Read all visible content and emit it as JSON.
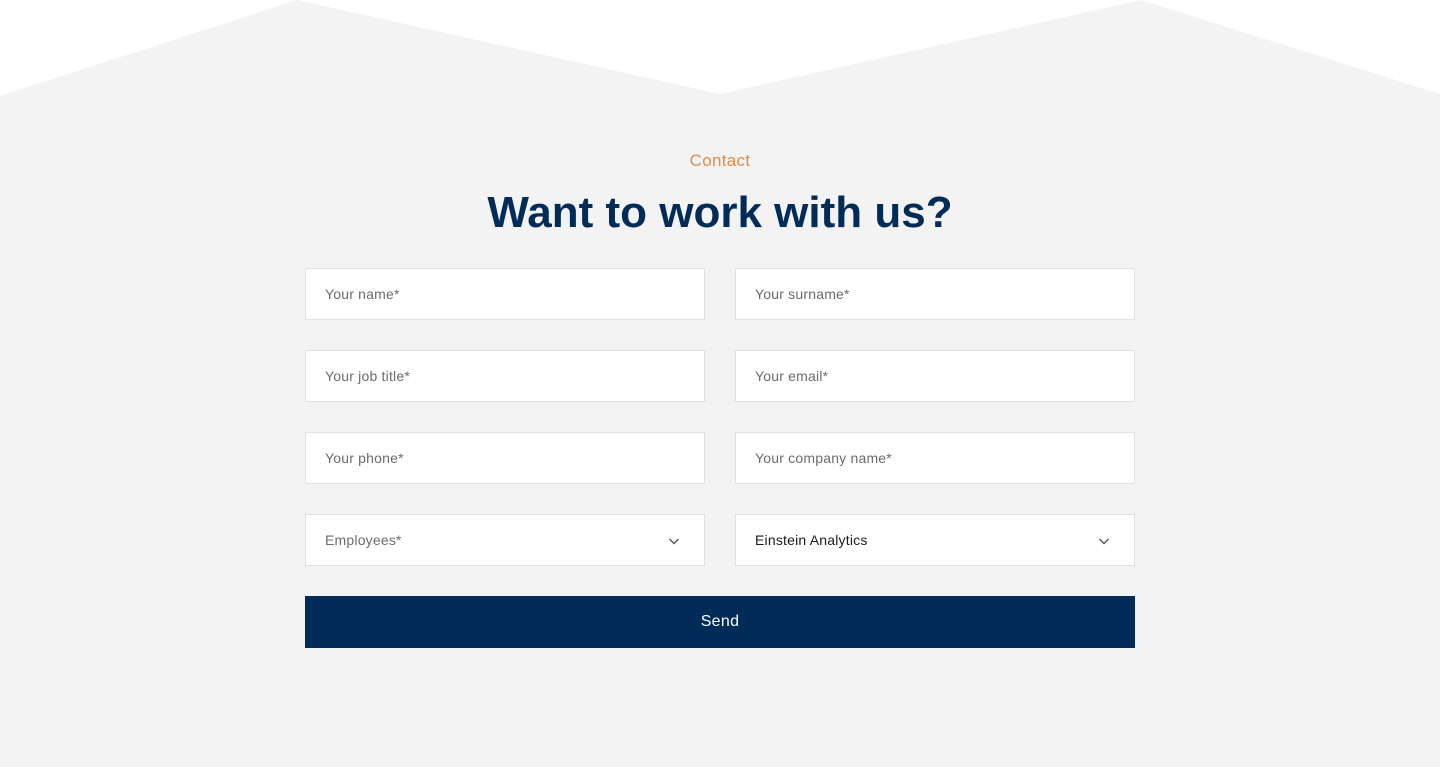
{
  "section": {
    "eyebrow": "Contact",
    "title": "Want to work with us?"
  },
  "form": {
    "name_placeholder": "Your name*",
    "surname_placeholder": "Your surname*",
    "job_title_placeholder": "Your job title*",
    "email_placeholder": "Your email*",
    "phone_placeholder": "Your phone*",
    "company_placeholder": "Your company name*",
    "employees_placeholder": "Employees*",
    "product_selected": "Einstein Analytics",
    "send_label": "Send"
  },
  "icons": {
    "dropdown": "chevron-down-icon"
  },
  "colors": {
    "accent": "#e38b45",
    "primary": "#002c57",
    "background": "#f3f3f3",
    "field_border": "#e1e1e1"
  }
}
